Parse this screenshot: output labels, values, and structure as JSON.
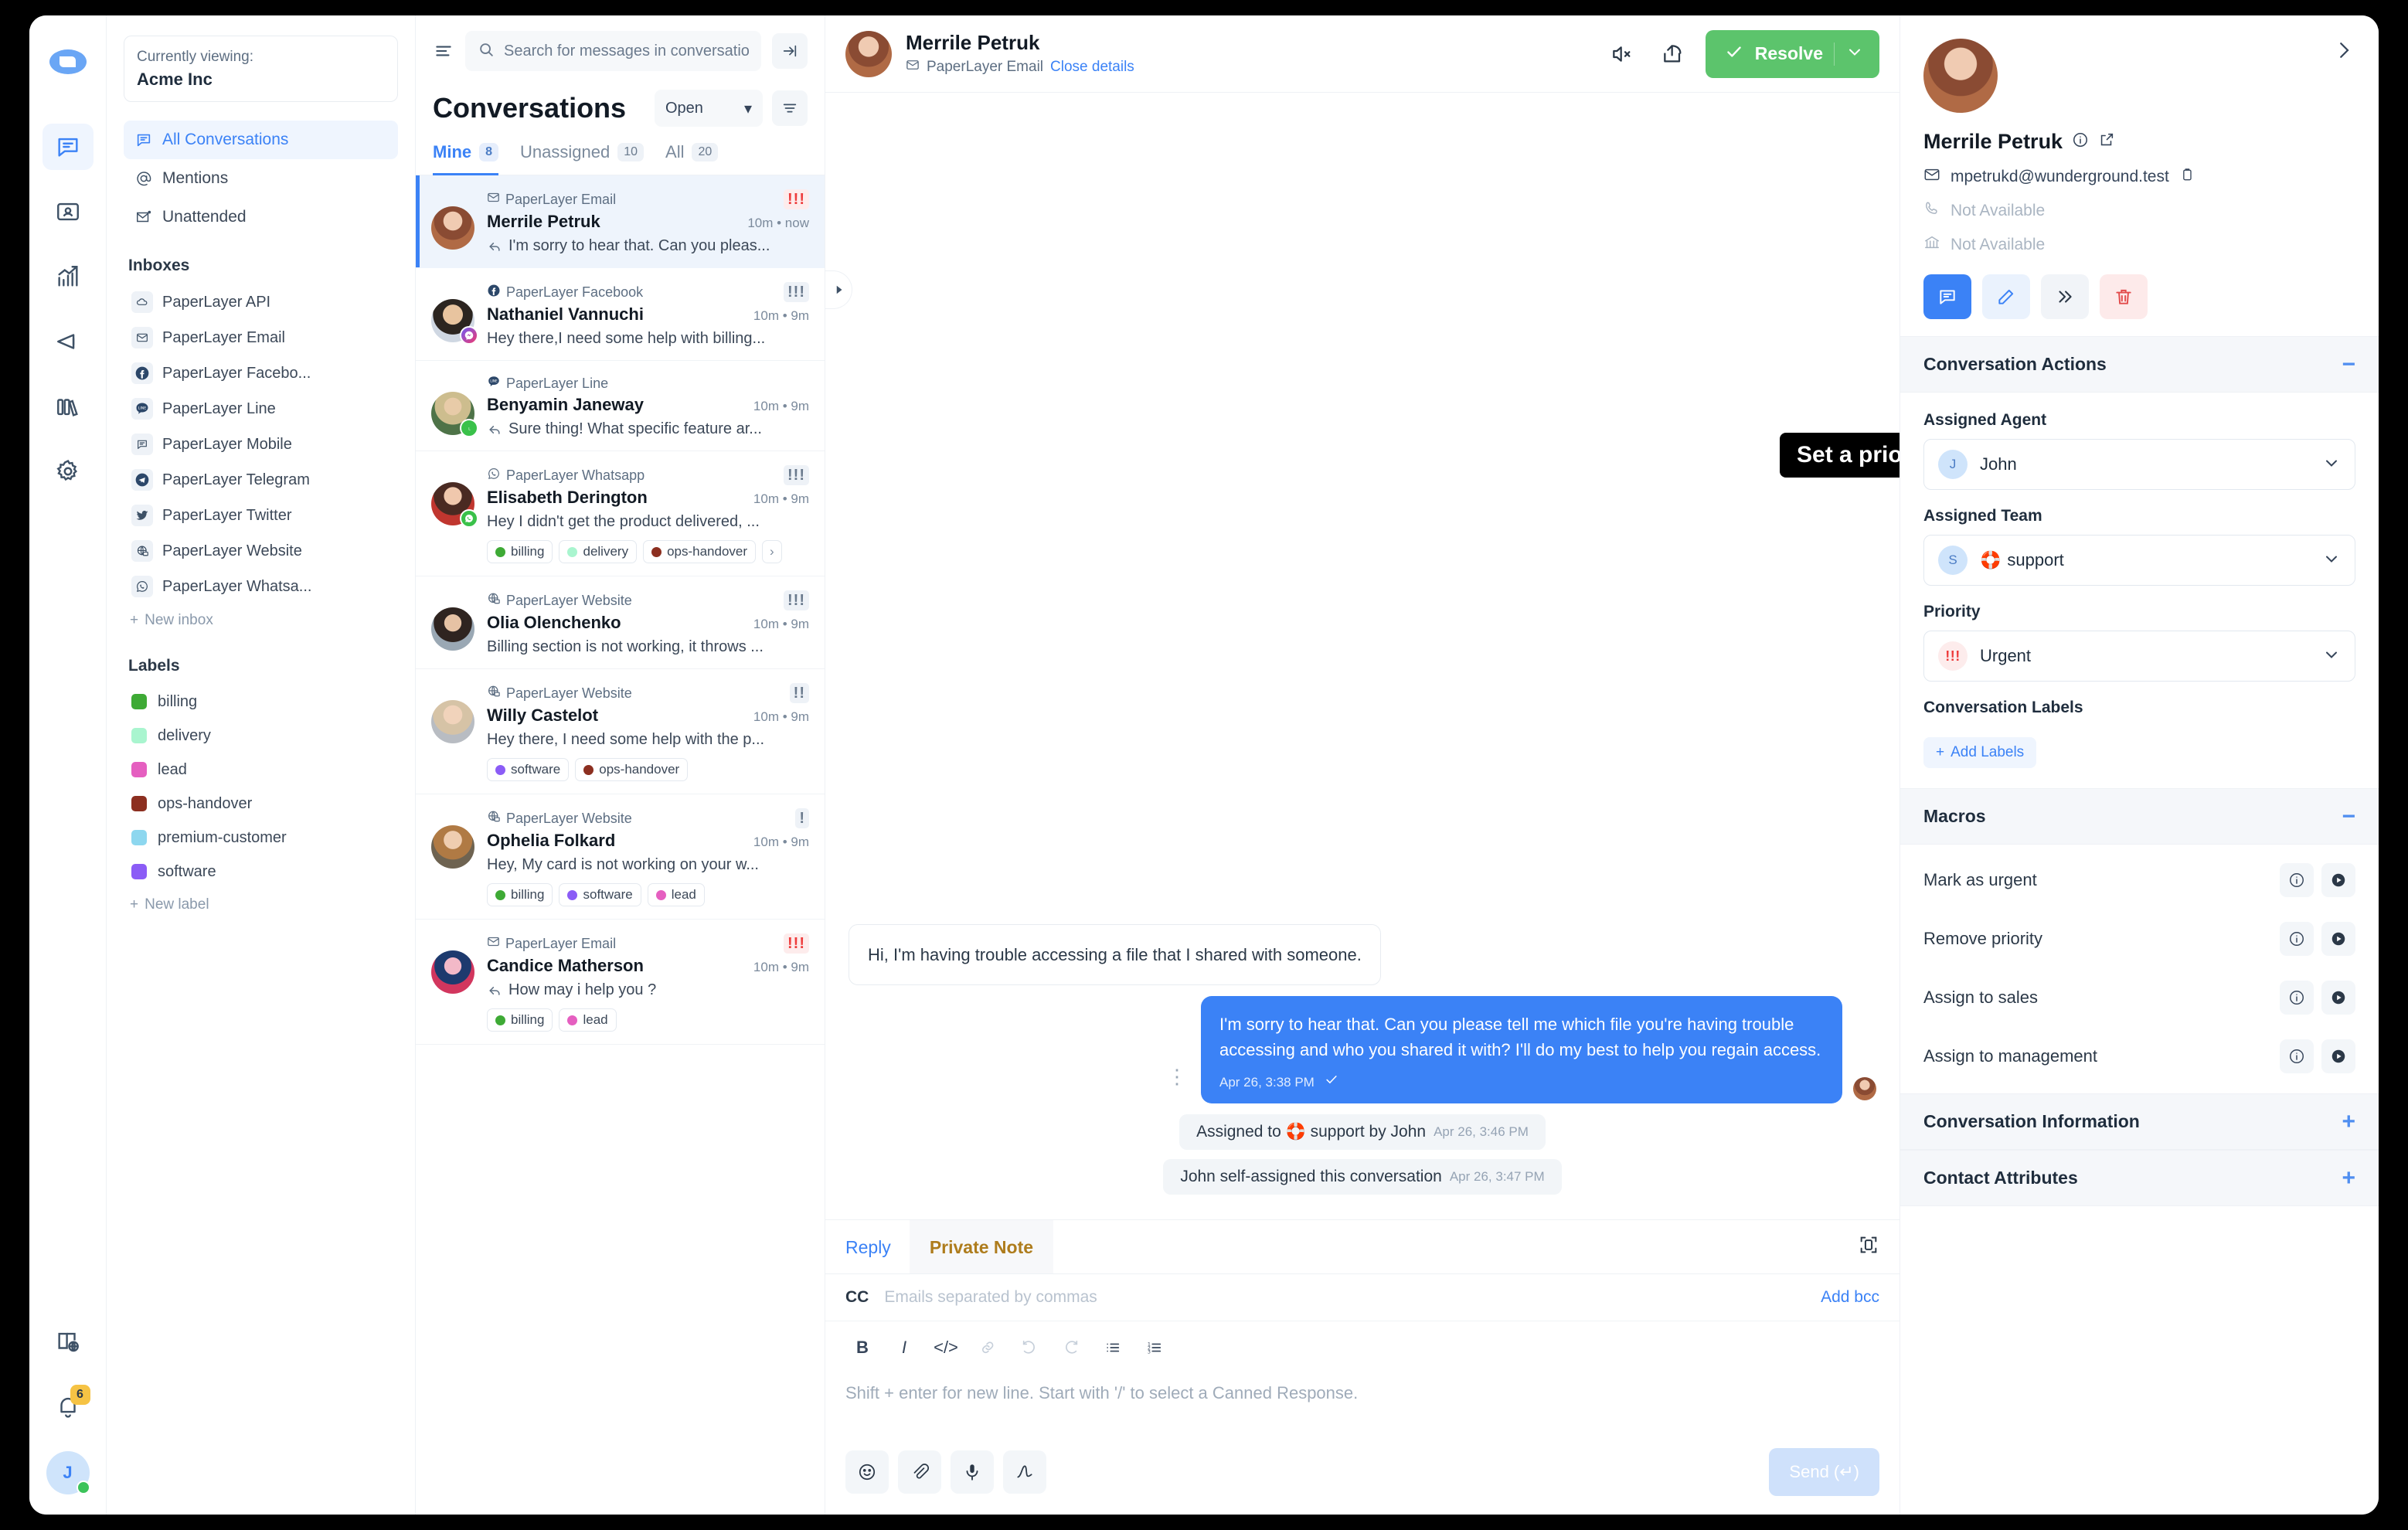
{
  "rail": {
    "logo_icon": "chatwoot-logo-icon",
    "items": [
      {
        "icon": "conversations-icon",
        "name": "conversations",
        "active": true
      },
      {
        "icon": "contacts-card-icon",
        "name": "contacts",
        "active": false
      },
      {
        "icon": "reports-chart-icon",
        "name": "reports",
        "active": false
      },
      {
        "icon": "campaigns-megaphone-icon",
        "name": "campaigns",
        "active": false
      },
      {
        "icon": "portals-books-icon",
        "name": "portals",
        "active": false
      },
      {
        "icon": "settings-gear-icon",
        "name": "settings",
        "active": false
      }
    ],
    "docs_icon": "docs-globe-icon",
    "notifications_count": "6",
    "user_initial": "J"
  },
  "sidebar": {
    "account_label": "Currently viewing:",
    "account_name": "Acme Inc",
    "nav": [
      {
        "label": "All Conversations",
        "icon": "conversation-icon",
        "active": true
      },
      {
        "label": "Mentions",
        "icon": "at-icon",
        "active": false
      },
      {
        "label": "Unattended",
        "icon": "unattended-mail-icon",
        "active": false
      }
    ],
    "inboxes_title": "Inboxes",
    "inboxes": [
      {
        "label": "PaperLayer API",
        "icon": "cloud-icon"
      },
      {
        "label": "PaperLayer Email",
        "icon": "email-icon"
      },
      {
        "label": "PaperLayer Facebo...",
        "icon": "facebook-icon"
      },
      {
        "label": "PaperLayer Line",
        "icon": "line-icon"
      },
      {
        "label": "PaperLayer Mobile",
        "icon": "mobile-chat-icon"
      },
      {
        "label": "PaperLayer Telegram",
        "icon": "telegram-icon"
      },
      {
        "label": "PaperLayer Twitter",
        "icon": "twitter-icon"
      },
      {
        "label": "PaperLayer Website",
        "icon": "website-globe-icon"
      },
      {
        "label": "PaperLayer Whatsa...",
        "icon": "whatsapp-icon"
      }
    ],
    "new_inbox": "New inbox",
    "labels_title": "Labels",
    "labels": [
      {
        "label": "billing",
        "color": "#3eaa35"
      },
      {
        "label": "delivery",
        "color": "#a9f5cf"
      },
      {
        "label": "lead",
        "color": "#e55fc0"
      },
      {
        "label": "ops-handover",
        "color": "#8c2f20"
      },
      {
        "label": "premium-customer",
        "color": "#8dd7ef"
      },
      {
        "label": "software",
        "color": "#8b5cf6"
      }
    ],
    "new_label": "New label"
  },
  "conversation_list": {
    "search_placeholder": "Search for messages in conversations",
    "search_value": "",
    "title": "Conversations",
    "status_filter": "Open",
    "tabs": [
      {
        "label": "Mine",
        "count": "8",
        "active": true
      },
      {
        "label": "Unassigned",
        "count": "10",
        "active": false
      },
      {
        "label": "All",
        "count": "20",
        "active": false
      }
    ],
    "items": [
      {
        "inbox": "PaperLayer Email",
        "inbox_icon": "email-icon",
        "name": "Merrile Petruk",
        "time": "10m • now",
        "snippet": "I'm sorry to hear that. Can you pleas...",
        "outgoing": true,
        "priority": "!!!",
        "priority_kind": "urgent",
        "avatar": "p1",
        "channel_badge": "",
        "labels": [],
        "selected": true
      },
      {
        "inbox": "PaperLayer Facebook",
        "inbox_icon": "facebook-icon",
        "name": "Nathaniel Vannuchi",
        "time": "10m • 9m",
        "snippet": "Hey there,I need some help with billing...",
        "outgoing": false,
        "priority": "!!!",
        "priority_kind": "high",
        "avatar": "p2",
        "channel_badge": "messenger",
        "labels": [],
        "selected": false
      },
      {
        "inbox": "PaperLayer Line",
        "inbox_icon": "line-icon",
        "name": "Benyamin Janeway",
        "time": "10m • 9m",
        "snippet": "Sure thing! What specific feature ar...",
        "outgoing": true,
        "priority": "",
        "priority_kind": "",
        "avatar": "p3",
        "channel_badge": "line",
        "labels": [],
        "selected": false
      },
      {
        "inbox": "PaperLayer Whatsapp",
        "inbox_icon": "whatsapp-icon",
        "name": "Elisabeth Derington",
        "time": "10m • 9m",
        "snippet": "Hey I didn't get the product delivered, ...",
        "outgoing": false,
        "priority": "!!!",
        "priority_kind": "high",
        "avatar": "p4",
        "channel_badge": "whatsapp",
        "labels": [
          {
            "label": "billing",
            "color": "#3eaa35"
          },
          {
            "label": "delivery",
            "color": "#a9f5cf"
          },
          {
            "label": "ops-handover",
            "color": "#8c2f20"
          }
        ],
        "more": "›",
        "selected": false
      },
      {
        "inbox": "PaperLayer Website",
        "inbox_icon": "website-globe-icon",
        "name": "Olia Olenchenko",
        "time": "10m • 9m",
        "snippet": "Billing section is not working, it throws ...",
        "outgoing": false,
        "priority": "!!!",
        "priority_kind": "high",
        "avatar": "p5",
        "channel_badge": "",
        "labels": [],
        "selected": false
      },
      {
        "inbox": "PaperLayer Website",
        "inbox_icon": "website-globe-icon",
        "name": "Willy Castelot",
        "time": "10m • 9m",
        "snippet": "Hey there, I need some help with the p...",
        "outgoing": false,
        "priority": "!!",
        "priority_kind": "medium",
        "avatar": "p6",
        "channel_badge": "",
        "labels": [
          {
            "label": "software",
            "color": "#8b5cf6"
          },
          {
            "label": "ops-handover",
            "color": "#8c2f20"
          }
        ],
        "selected": false
      },
      {
        "inbox": "PaperLayer Website",
        "inbox_icon": "website-globe-icon",
        "name": "Ophelia Folkard",
        "time": "10m • 9m",
        "snippet": "Hey, My card is not working on your w...",
        "outgoing": false,
        "priority": "!",
        "priority_kind": "low",
        "avatar": "p7",
        "channel_badge": "",
        "labels": [
          {
            "label": "billing",
            "color": "#3eaa35"
          },
          {
            "label": "software",
            "color": "#8b5cf6"
          },
          {
            "label": "lead",
            "color": "#e55fc0"
          }
        ],
        "selected": false
      },
      {
        "inbox": "PaperLayer Email",
        "inbox_icon": "email-icon",
        "name": "Candice Matherson",
        "time": "10m • 9m",
        "snippet": "How may i help you ?",
        "outgoing": true,
        "priority": "!!!",
        "priority_kind": "urgent",
        "avatar": "p8",
        "channel_badge": "",
        "labels": [
          {
            "label": "billing",
            "color": "#3eaa35"
          },
          {
            "label": "lead",
            "color": "#e55fc0"
          }
        ],
        "selected": false
      }
    ]
  },
  "main": {
    "contact_name": "Merrile Petruk",
    "inbox_name": "PaperLayer Email",
    "close_details": "Close details",
    "mute_icon": "mute-speaker-icon",
    "share_icon": "share-icon",
    "resolve_label": "Resolve",
    "messages": [
      {
        "kind": "incoming",
        "text": "Hi, I'm having trouble accessing a file that I shared with someone."
      },
      {
        "kind": "outgoing",
        "text": "I'm sorry to hear that. Can you please tell me which file you're having trouble accessing and who you shared it with? I'll do my best to help you regain access.",
        "time": "Apr 26, 3:38 PM"
      },
      {
        "kind": "system",
        "text": "Assigned to 🛟 support by John",
        "time": "Apr 26, 3:46 PM"
      },
      {
        "kind": "system",
        "text": "John self-assigned this conversation",
        "time": "Apr 26, 3:47 PM"
      }
    ],
    "callout": "Set a priority"
  },
  "composer": {
    "tab_reply": "Reply",
    "tab_note": "Private Note",
    "cc_label": "CC",
    "cc_placeholder": "Emails separated by commas",
    "cc_value": "",
    "add_bcc": "Add bcc",
    "format_buttons": [
      "bold-icon",
      "italic-icon",
      "code-icon",
      "link-icon",
      "undo-icon",
      "redo-icon",
      "bullet-list-icon",
      "numbered-list-icon"
    ],
    "editor_placeholder": "Shift + enter for new line. Start with '/' to select a Canned Response.",
    "editor_value": "",
    "foot_buttons": [
      "emoji-icon",
      "attachment-icon",
      "microphone-icon",
      "signature-icon"
    ],
    "send_label": "Send (↵)"
  },
  "right_panel": {
    "contact_name": "Merrile Petruk",
    "email": "mpetrukd@wunderground.test",
    "phone": "Not Available",
    "company": "Not Available",
    "actions": [
      {
        "icon": "new-conversation-icon",
        "style": "blue"
      },
      {
        "icon": "edit-pencil-icon",
        "style": "lblue"
      },
      {
        "icon": "merge-icon",
        "style": "grey"
      },
      {
        "icon": "delete-trash-icon",
        "style": "red"
      }
    ],
    "conversation_actions": {
      "title": "Conversation Actions",
      "expanded": true,
      "assigned_agent_label": "Assigned Agent",
      "assigned_agent": "John",
      "assigned_agent_initial": "J",
      "assigned_team_label": "Assigned Team",
      "assigned_team": "support",
      "assigned_team_initial": "S",
      "assigned_team_emoji": "🛟",
      "priority_label": "Priority",
      "priority": "Urgent",
      "priority_mark": "!!!",
      "labels_label": "Conversation Labels",
      "add_labels": "Add Labels"
    },
    "macros": {
      "title": "Macros",
      "expanded": true,
      "items": [
        "Mark as urgent",
        "Remove priority",
        "Assign to sales",
        "Assign to management"
      ]
    },
    "conversation_information": {
      "title": "Conversation Information",
      "expanded": false
    },
    "contact_attributes": {
      "title": "Contact Attributes",
      "expanded": false
    }
  },
  "colors": {
    "accent": "#3b82f6",
    "resolve_green": "#5cc46c",
    "urgent_red": "#ee3c3c",
    "note_amber": "#ae7c1c",
    "badge_yellow": "#f6c344"
  }
}
